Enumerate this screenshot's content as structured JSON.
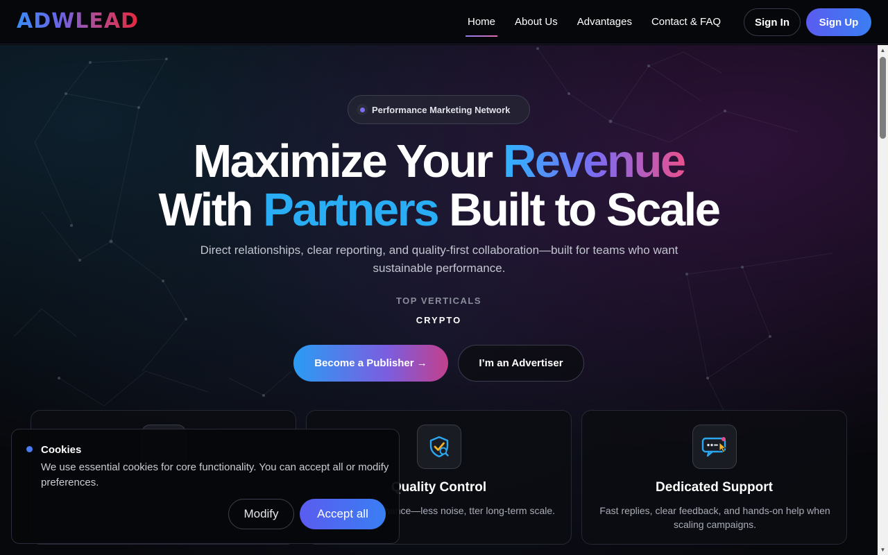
{
  "header": {
    "logo_text": "ADWLEAD",
    "nav": [
      {
        "label": "Home",
        "active": true
      },
      {
        "label": "About Us",
        "active": false
      },
      {
        "label": "Advantages",
        "active": false
      },
      {
        "label": "Contact & FAQ",
        "active": false
      }
    ],
    "sign_in_label": "Sign In",
    "sign_up_label": "Sign Up"
  },
  "hero": {
    "badge": "Performance Marketing Network",
    "headline": {
      "line1_prefix": "Maximize Your ",
      "line1_highlight": "Revenue",
      "line2_prefix": "With ",
      "line2_highlight": "Partners",
      "line2_suffix": " Built to Scale"
    },
    "subtitle": "Direct relationships, clear reporting, and quality-first collaboration—built for teams who want sustainable performance.",
    "verticals_label": "TOP VERTICALS",
    "verticals_value": "CRYPTO",
    "publisher_button": "Become a Publisher  →",
    "advertiser_button": "I’m an Advertiser"
  },
  "cards": [
    {
      "title": "",
      "description": "",
      "icon": "card-icon"
    },
    {
      "title": "Quality Control",
      "description": "protect performance—less noise, tter long-term scale.",
      "icon": "shield-check-icon"
    },
    {
      "title": "Dedicated Support",
      "description": "Fast replies, clear feedback, and hands-on help when scaling campaigns.",
      "icon": "chat-support-icon"
    }
  ],
  "cookie_banner": {
    "title": "Cookies",
    "text": "We use essential cookies for core functionality. You can accept all or modify preferences.",
    "modify_label": "Modify",
    "accept_label": "Accept all"
  },
  "colors": {
    "accent_blue": "#3a7ef2",
    "accent_purple": "#5a5cf0",
    "accent_pink": "#e9518e",
    "cyan": "#29aef5",
    "background": "#07080c"
  }
}
